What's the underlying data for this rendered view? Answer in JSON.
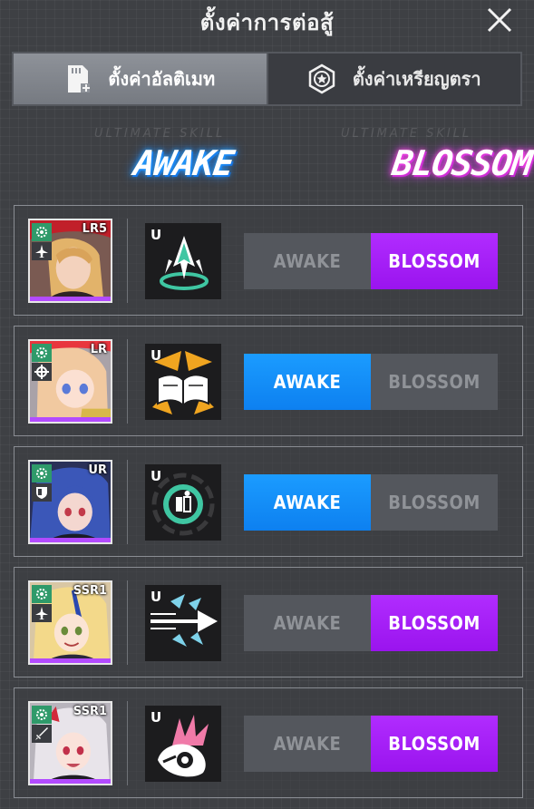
{
  "dialog": {
    "title": "ตั้งค่าการต่อสู้",
    "close_icon": "close-icon"
  },
  "tabs": [
    {
      "label": "ตั้งค่าอัลติเมท",
      "icon": "sd-card-icon",
      "active": true
    },
    {
      "label": "ตั้งค่าเหรียญตรา",
      "icon": "medal-hexagon-icon",
      "active": false
    }
  ],
  "header": {
    "awake_logo": "AWAKE",
    "blossom_logo": "BLOSSOM",
    "awake_sublabel": "ULTIMATE SKILL",
    "blossom_sublabel": "ULTIMATE SKILL"
  },
  "characters": [
    {
      "rarity": "LR5",
      "class_icon": "jet-icon",
      "skill_icon": "skill-spire-icon",
      "selected": "blossom",
      "awake_label": "AWAKE",
      "blossom_label": "BLOSSOM"
    },
    {
      "rarity": "LR",
      "class_icon": "crosshair-icon",
      "skill_icon": "skill-book-icon",
      "selected": "awake",
      "awake_label": "AWAKE",
      "blossom_label": "BLOSSOM"
    },
    {
      "rarity": "UR",
      "class_icon": "shield-icon",
      "skill_icon": "skill-target-icon",
      "selected": "awake",
      "awake_label": "AWAKE",
      "blossom_label": "BLOSSOM"
    },
    {
      "rarity": "SSR1",
      "class_icon": "jet-icon",
      "skill_icon": "skill-arrow-icon",
      "selected": "blossom",
      "awake_label": "AWAKE",
      "blossom_label": "BLOSSOM"
    },
    {
      "rarity": "SSR1",
      "class_icon": "sword-icon",
      "skill_icon": "skill-explosion-icon",
      "selected": "blossom",
      "awake_label": "AWAKE",
      "blossom_label": "BLOSSOM"
    }
  ],
  "colors": {
    "awake_active": "#1b9cff",
    "blossom_active": "#a51ff7",
    "inactive": "#54575d",
    "portrait_bar": "#b34bff"
  }
}
